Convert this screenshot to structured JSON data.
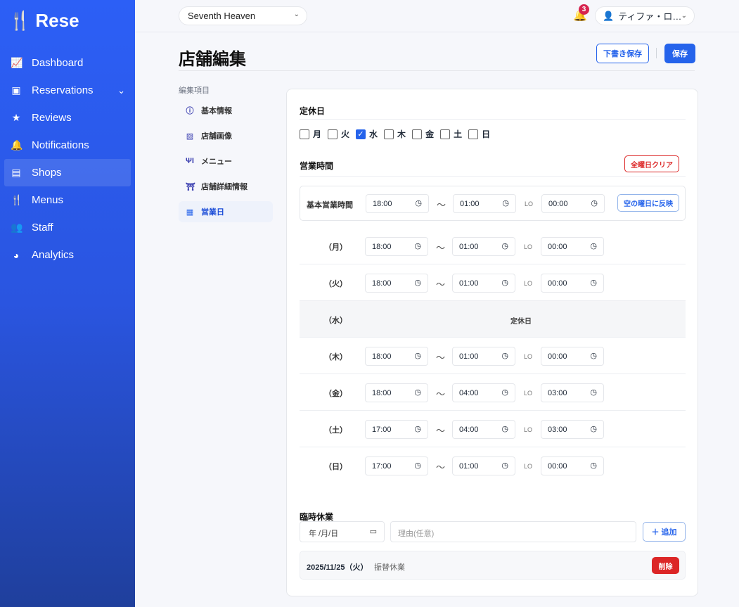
{
  "app": {
    "name": "Rese"
  },
  "sidebar": {
    "items": [
      {
        "label": "Dashboard",
        "icon": "chart-line-icon"
      },
      {
        "label": "Reservations",
        "icon": "calendar-check-icon"
      },
      {
        "label": "Reviews",
        "icon": "star-icon"
      },
      {
        "label": "Notifications",
        "icon": "bell-icon"
      },
      {
        "label": "Shops",
        "icon": "store-icon"
      },
      {
        "label": "Menus",
        "icon": "utensils-icon"
      },
      {
        "label": "Staff",
        "icon": "users-icon"
      },
      {
        "label": "Analytics",
        "icon": "pie-chart-icon"
      }
    ]
  },
  "topbar": {
    "shop": "Seventh Heaven",
    "notif_count": "3",
    "user": "ティファ・ロ…"
  },
  "page": {
    "title": "店舗編集",
    "draft_label": "下書き保存",
    "save_label": "保存"
  },
  "subnav": {
    "heading": "編集項目",
    "items": [
      {
        "label": "基本情報"
      },
      {
        "label": "店舗画像"
      },
      {
        "label": "メニュー"
      },
      {
        "label": "店舗詳細情報"
      },
      {
        "label": "営業日"
      }
    ]
  },
  "closed_days": {
    "heading": "定休日",
    "days": [
      {
        "label": "月",
        "checked": false
      },
      {
        "label": "火",
        "checked": false
      },
      {
        "label": "水",
        "checked": true
      },
      {
        "label": "木",
        "checked": false
      },
      {
        "label": "金",
        "checked": false
      },
      {
        "label": "土",
        "checked": false
      },
      {
        "label": "日",
        "checked": false
      }
    ]
  },
  "hours": {
    "heading": "営業時間",
    "clear_label": "全曜日クリア",
    "tilde": "～",
    "lo": "LO",
    "base": {
      "label": "基本営業時間",
      "open": "18:00",
      "close": "01:00",
      "lo": "00:00",
      "reflect_label": "空の曜日に反映"
    },
    "closed_text": "定休日",
    "rows": [
      {
        "day": "（月）",
        "open": "18:00",
        "close": "01:00",
        "lo": "00:00"
      },
      {
        "day": "（火）",
        "open": "18:00",
        "close": "01:00",
        "lo": "00:00"
      },
      {
        "day": "（水）",
        "closed": true
      },
      {
        "day": "（木）",
        "open": "18:00",
        "close": "01:00",
        "lo": "00:00"
      },
      {
        "day": "（金）",
        "open": "18:00",
        "close": "04:00",
        "lo": "03:00"
      },
      {
        "day": "（土）",
        "open": "17:00",
        "close": "04:00",
        "lo": "03:00"
      },
      {
        "day": "（日）",
        "open": "17:00",
        "close": "01:00",
        "lo": "00:00"
      }
    ]
  },
  "temp_closure": {
    "heading": "臨時休業",
    "date_placeholder": "年 /月/日",
    "reason_placeholder": "理由(任意)",
    "add_label": "追加",
    "entries": [
      {
        "date": "2025/11/25（火）",
        "reason": "振替休業",
        "delete_label": "削除"
      }
    ]
  }
}
